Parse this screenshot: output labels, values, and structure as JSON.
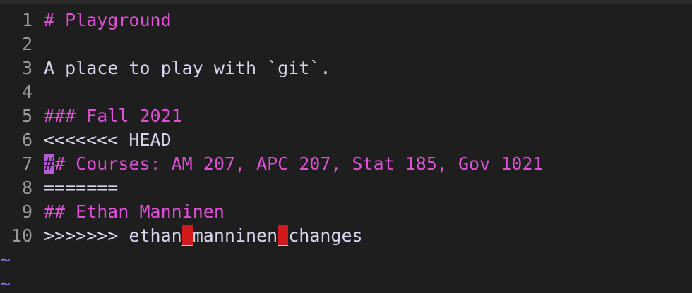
{
  "editor": {
    "lines": [
      {
        "num": "1",
        "segments": [
          {
            "text": "# Playground",
            "style": "heading"
          }
        ]
      },
      {
        "num": "2",
        "segments": []
      },
      {
        "num": "3",
        "segments": [
          {
            "text": "A place to play with `git`.",
            "style": "text"
          }
        ]
      },
      {
        "num": "4",
        "segments": []
      },
      {
        "num": "5",
        "segments": [
          {
            "text": "### Fall 2021",
            "style": "heading"
          }
        ]
      },
      {
        "num": "6",
        "segments": [
          {
            "text": "<<<<<<< HEAD",
            "style": "marker"
          }
        ]
      },
      {
        "num": "7",
        "segments": [
          {
            "text": "#",
            "style": "cursor"
          },
          {
            "text": "# Courses: AM 207, APC 207, Stat 185, Gov 1021",
            "style": "heading"
          }
        ]
      },
      {
        "num": "8",
        "segments": [
          {
            "text": "=======",
            "style": "marker"
          }
        ]
      },
      {
        "num": "9",
        "segments": [
          {
            "text": "## Ethan Manninen",
            "style": "heading"
          }
        ]
      },
      {
        "num": "10",
        "segments": [
          {
            "text": ">>>>>>> ethan",
            "style": "marker"
          },
          {
            "text": "_",
            "style": "err"
          },
          {
            "text": "manninen",
            "style": "marker"
          },
          {
            "text": "_",
            "style": "err"
          },
          {
            "text": "changes",
            "style": "marker"
          }
        ]
      }
    ],
    "empty_line_marker": "~",
    "empty_lines_count": 2
  },
  "colors": {
    "background": "#1e1e1e",
    "line_number": "#9a9a9a",
    "heading": "#e04fd8",
    "text": "#d8d4f0",
    "cursor": "#b45cd6",
    "error_highlight": "#d11a1a",
    "tilde": "#7b6fd6"
  }
}
